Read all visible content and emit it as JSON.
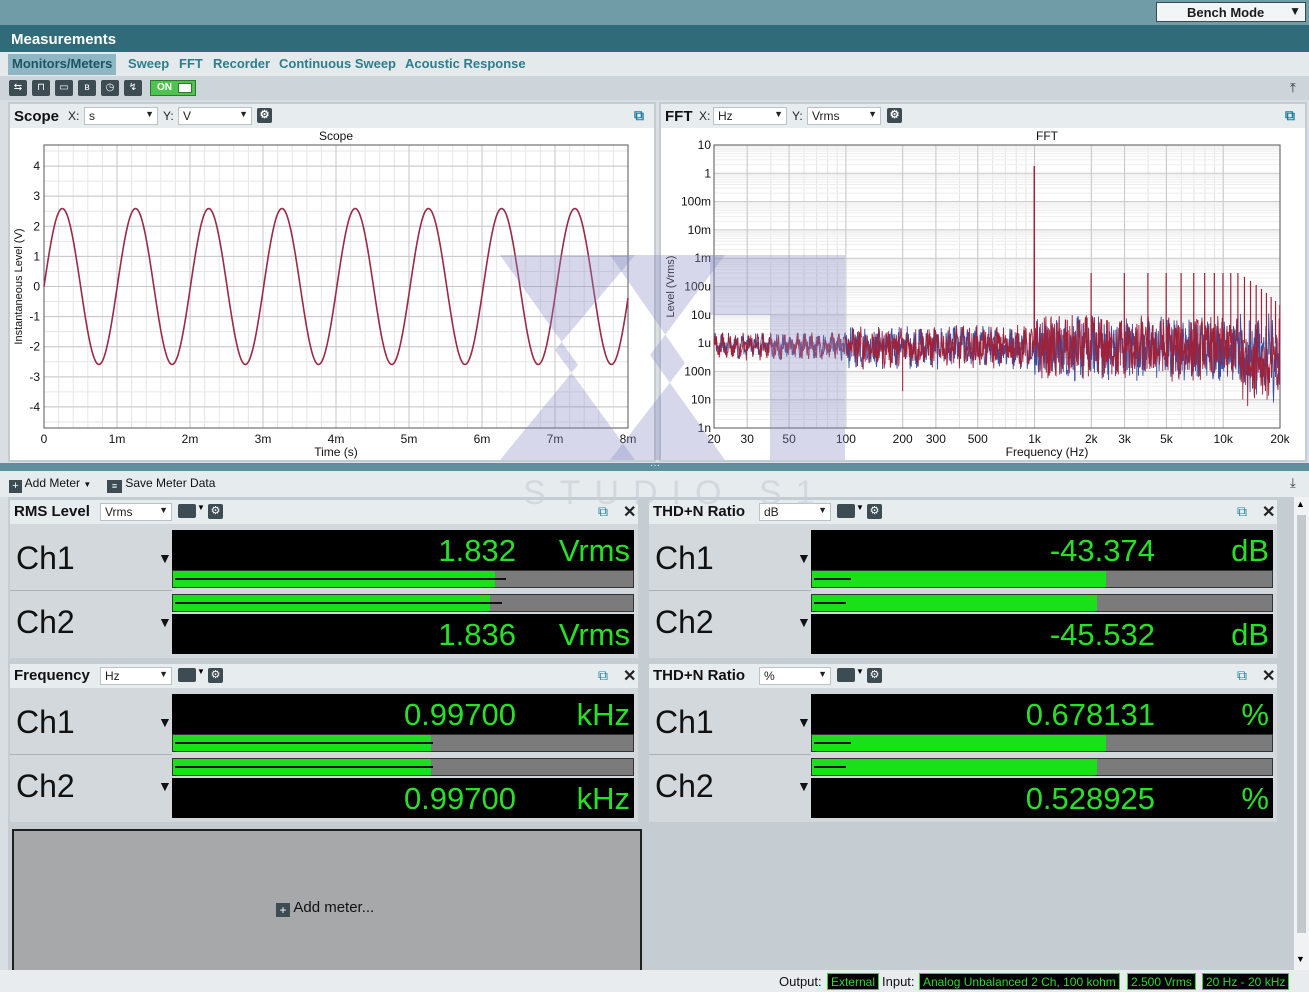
{
  "header": {
    "bench_mode": "Bench Mode",
    "section_title": "Measurements"
  },
  "tabs": [
    "Monitors/Meters",
    "Sweep",
    "FFT",
    "Recorder",
    "Continuous Sweep",
    "Acoustic Response"
  ],
  "toolbar": {
    "on_label": "ON"
  },
  "scope": {
    "title": "Scope",
    "x_label": "X:",
    "x_unit": "s",
    "y_label": "Y:",
    "y_unit": "V",
    "chart_data": {
      "type": "line",
      "title": "Scope",
      "xlabel": "Time (s)",
      "ylabel": "Instantaneous Level (V)",
      "x_ticks": [
        "0",
        "1m",
        "2m",
        "3m",
        "4m",
        "5m",
        "6m",
        "7m",
        "8m"
      ],
      "y_ticks": [
        "4",
        "3",
        "2",
        "1",
        "0",
        "-1",
        "-2",
        "-3",
        "-4"
      ],
      "xlim": [
        0,
        0.008
      ],
      "ylim": [
        -4.7,
        4.7
      ],
      "series": [
        {
          "amplitude": 2.59,
          "frequency_hz": 997,
          "color": "#9a2a45"
        }
      ]
    }
  },
  "fft": {
    "title": "FFT",
    "x_label": "X:",
    "x_unit": "Hz",
    "y_label": "Y:",
    "y_unit": "Vrms",
    "chart_data": {
      "type": "line",
      "title": "FFT",
      "xlabel": "Frequency (Hz)",
      "ylabel": "Level (Vrms)",
      "x_scale": "log",
      "y_scale": "log",
      "xlim": [
        20,
        20000
      ],
      "ylim": [
        1e-09,
        10
      ],
      "x_ticks": [
        "20",
        "30",
        "50",
        "100",
        "200",
        "300",
        "500",
        "1k",
        "2k",
        "3k",
        "5k",
        "10k",
        "20k"
      ],
      "y_ticks": [
        "10",
        "1",
        "100m",
        "10m",
        "1m",
        "100u",
        "10u",
        "1u",
        "100n",
        "10n",
        "1n"
      ],
      "fundamental": {
        "freq": 997,
        "level": 1.8
      },
      "harmonic_level_approx": 0.0003,
      "noise_floor_approx": 1e-06,
      "series_colors": [
        "#a0213a",
        "#3a4ea0"
      ]
    }
  },
  "meter_toolbar": {
    "add_meter": "Add Meter",
    "save_meter_data": "Save Meter Data"
  },
  "meters": [
    {
      "title": "RMS Level",
      "unit_sel": "Vrms",
      "ch": [
        {
          "label": "Ch1",
          "value": "1.832",
          "unit": "Vrms",
          "fill": 0.7,
          "line": 0.72
        },
        {
          "label": "Ch2",
          "value": "1.836",
          "unit": "Vrms",
          "fill": 0.69,
          "line": 0.71
        }
      ]
    },
    {
      "title": "THD+N Ratio",
      "unit_sel": "dB",
      "ch": [
        {
          "label": "Ch1",
          "value": "-43.374",
          "unit": "dB",
          "fill": 0.64,
          "line": 0.08
        },
        {
          "label": "Ch2",
          "value": "-45.532",
          "unit": "dB",
          "fill": 0.62,
          "line": 0.07
        }
      ]
    },
    {
      "title": "Frequency",
      "unit_sel": "Hz",
      "ch": [
        {
          "label": "Ch1",
          "value": "0.99700",
          "unit": "kHz",
          "fill": 0.56,
          "line": 0.56
        },
        {
          "label": "Ch2",
          "value": "0.99700",
          "unit": "kHz",
          "fill": 0.56,
          "line": 0.56
        }
      ]
    },
    {
      "title": "THD+N Ratio",
      "unit_sel": "%",
      "ch": [
        {
          "label": "Ch1",
          "value": "0.678131",
          "unit": "%",
          "fill": 0.64,
          "line": 0.08
        },
        {
          "label": "Ch2",
          "value": "0.528925",
          "unit": "%",
          "fill": 0.62,
          "line": 0.07
        }
      ]
    }
  ],
  "add_meter_placeholder": "Add meter...",
  "watermark": "STUDIO S1",
  "status": {
    "output_label": "Output:",
    "output_value": "External",
    "input_label": "Input:",
    "input_value": "Analog Unbalanced 2 Ch, 100 kohm",
    "level": "2.500 Vrms",
    "bandwidth": "20 Hz - 20 kHz"
  }
}
